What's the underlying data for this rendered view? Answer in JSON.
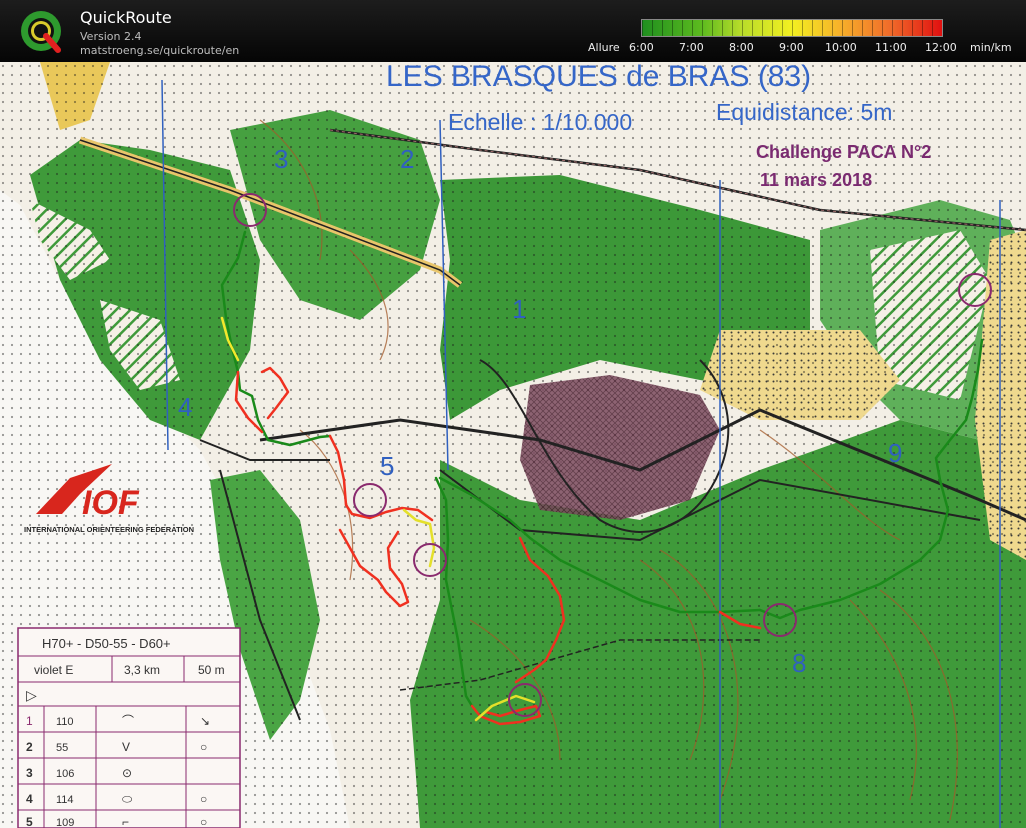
{
  "app": {
    "title": "QuickRoute",
    "version": "Version 2.4",
    "url": "matstroeng.se/quickroute/en"
  },
  "pace_legend": {
    "label": "Allure",
    "ticks": [
      "6:00",
      "7:00",
      "8:00",
      "9:00",
      "10:00",
      "11:00",
      "12:00"
    ],
    "unit": "min/km",
    "gradient_colors": [
      "#1f8f1f",
      "#b8dc2a",
      "#f3f021",
      "#f7b12a",
      "#e01010"
    ]
  },
  "map": {
    "title": "LES BRASQUES de BRAS (83)",
    "scale": "Echelle  : 1/10.000",
    "equidistance": "Equidistance: 5m",
    "event": "Challenge PACA N°2",
    "date": "11 mars 2018",
    "federation_logo": "IOF",
    "federation_name": "INTERNATIONAL ORIENTEERING FEDERATION",
    "control_numbers": [
      "1",
      "2",
      "3",
      "4",
      "5",
      "8",
      "9"
    ],
    "colors": {
      "forest": "#3f9a3a",
      "open": "#f4efe2",
      "yellow": "#e8d28c",
      "contour": "#a35a2a",
      "purple": "#8a2a6e",
      "water_line": "#3060c0"
    }
  },
  "control_card": {
    "header": "H70+ - D50-55 - D60+",
    "course": "violet E",
    "distance": "3,3 km",
    "climb": "50 m",
    "start_symbol": "▷",
    "rows": [
      {
        "num": "1",
        "code": "110",
        "feature": "⌒",
        "detail": "↘"
      },
      {
        "num": "2",
        "code": "55",
        "feature": "V",
        "detail": "○"
      },
      {
        "num": "3",
        "code": "106",
        "feature": "⊙",
        "detail": ""
      },
      {
        "num": "4",
        "code": "114",
        "feature": "⬭",
        "detail": "○"
      },
      {
        "num": "5",
        "code": "109",
        "feature": "⌐",
        "detail": "○"
      }
    ]
  }
}
